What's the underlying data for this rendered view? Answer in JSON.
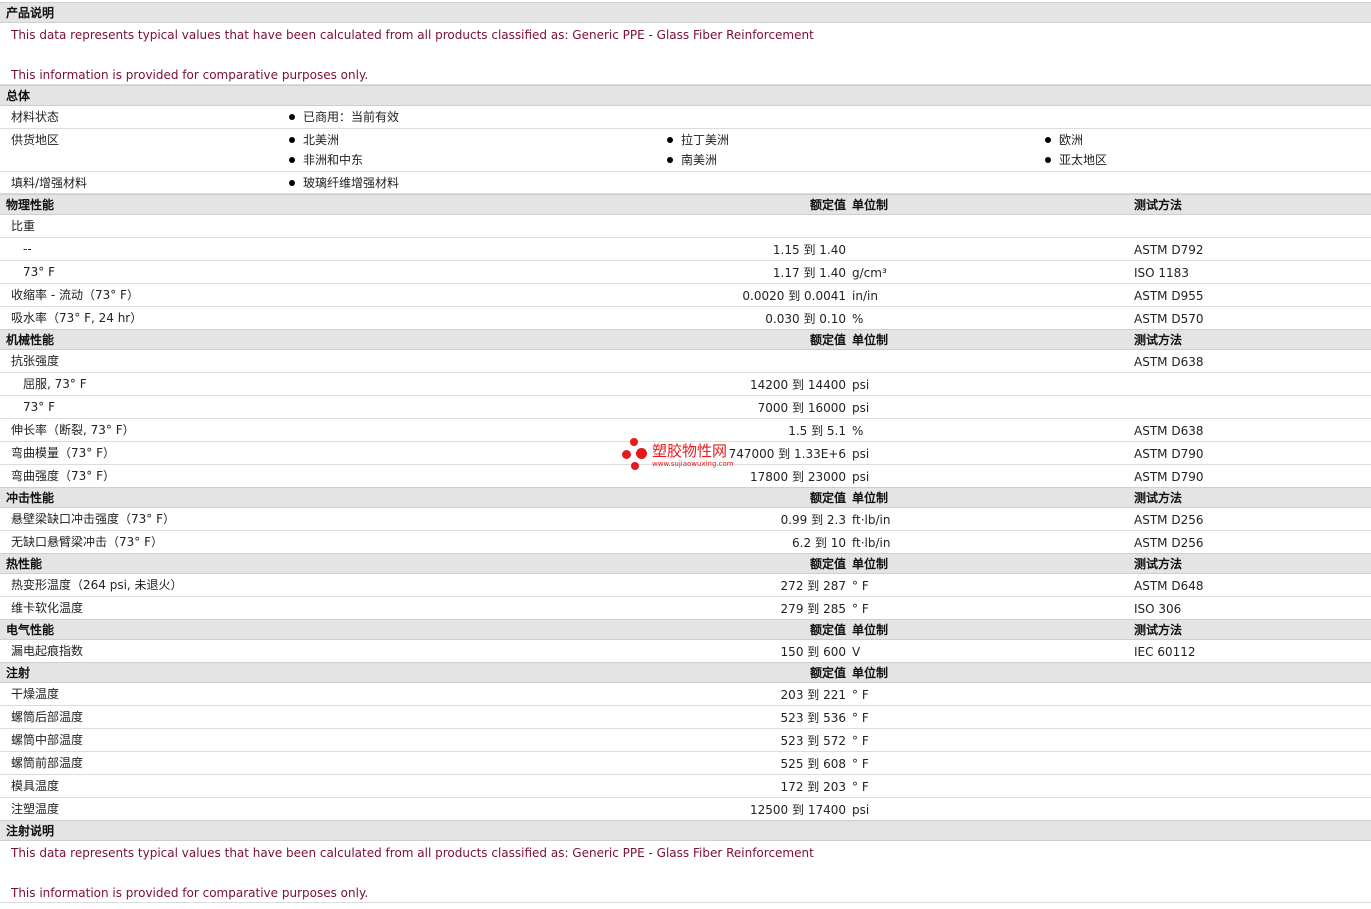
{
  "sections": {
    "desc": {
      "title": "产品说明",
      "line1": "This data represents typical values that have been calculated from all products classified as: Generic PPE - Glass Fiber Reinforcement",
      "line2": "This information is provided for comparative purposes only."
    },
    "general": {
      "title": "总体",
      "status_label": "材料状态",
      "status_value": "已商用：当前有效",
      "avail_label": "供货地区",
      "regions": [
        "北美洲",
        "拉丁美洲",
        "欧洲",
        "非洲和中东",
        "南美洲",
        "亚太地区"
      ],
      "filler_label": "填料/增强材料",
      "filler_value": "玻璃纤维增强材料"
    },
    "physical": {
      "title": "物理性能",
      "col_value": "额定值",
      "col_unit": "单位制",
      "col_method": "测试方法",
      "rows": [
        {
          "label": "比重",
          "value": "",
          "unit": "",
          "method": ""
        },
        {
          "label": "--",
          "value": "1.15 到  1.40",
          "unit": "",
          "method": "ASTM D792"
        },
        {
          "label": "73° F",
          "value": "1.17 到  1.40",
          "unit": "g/cm³",
          "method": "ISO 1183"
        },
        {
          "label": "收缩率 - 流动（73° F）",
          "value": "0.0020 到  0.0041",
          "unit": "in/in",
          "method": "ASTM D955"
        },
        {
          "label": "吸水率（73° F, 24 hr）",
          "value": "0.030 到  0.10",
          "unit": "%",
          "method": "ASTM D570"
        }
      ]
    },
    "mechanical": {
      "title": "机械性能",
      "col_value": "额定值",
      "col_unit": "单位制",
      "col_method": "测试方法",
      "rows": [
        {
          "label": "抗张强度",
          "value": "",
          "unit": "",
          "method": "ASTM D638"
        },
        {
          "label": "屈服, 73° F",
          "value": "14200 到  14400",
          "unit": "psi",
          "method": ""
        },
        {
          "label": "73° F",
          "value": "7000 到  16000",
          "unit": "psi",
          "method": ""
        },
        {
          "label": "伸长率（断裂, 73° F）",
          "value": "1.5 到  5.1",
          "unit": "%",
          "method": "ASTM D638"
        },
        {
          "label": "弯曲模量（73° F）",
          "value": "747000 到  1.33E+6",
          "unit": "psi",
          "method": "ASTM D790"
        },
        {
          "label": "弯曲强度（73° F）",
          "value": "17800 到  23000",
          "unit": "psi",
          "method": "ASTM D790"
        }
      ]
    },
    "impact": {
      "title": "冲击性能",
      "col_value": "额定值",
      "col_unit": "单位制",
      "col_method": "测试方法",
      "rows": [
        {
          "label": "悬壁梁缺口冲击强度（73° F）",
          "value": "0.99 到  2.3",
          "unit": "ft·lb/in",
          "method": "ASTM D256"
        },
        {
          "label": "无缺口悬臂梁冲击（73° F）",
          "value": "6.2 到  10",
          "unit": "ft·lb/in",
          "method": "ASTM D256"
        }
      ]
    },
    "thermal": {
      "title": "热性能",
      "col_value": "额定值",
      "col_unit": "单位制",
      "col_method": "测试方法",
      "rows": [
        {
          "label": "热变形温度（264 psi, 未退火）",
          "value": "272 到  287",
          "unit": "° F",
          "method": "ASTM D648"
        },
        {
          "label": "维卡软化温度",
          "value": "279 到  285",
          "unit": "° F",
          "method": "ISO 306"
        }
      ]
    },
    "electrical": {
      "title": "电气性能",
      "col_value": "额定值",
      "col_unit": "单位制",
      "col_method": "测试方法",
      "rows": [
        {
          "label": "漏电起痕指数",
          "value": "150 到  600",
          "unit": "V",
          "method": "IEC 60112"
        }
      ]
    },
    "injection": {
      "title": "注射",
      "col_value": "额定值",
      "col_unit": "单位制",
      "rows": [
        {
          "label": "干燥温度",
          "value": "203 到  221",
          "unit": "° F",
          "method": ""
        },
        {
          "label": "螺筒后部温度",
          "value": "523 到  536",
          "unit": "° F",
          "method": ""
        },
        {
          "label": "螺筒中部温度",
          "value": "523 到  572",
          "unit": "° F",
          "method": ""
        },
        {
          "label": "螺筒前部温度",
          "value": "525 到  608",
          "unit": "° F",
          "method": ""
        },
        {
          "label": "模具温度",
          "value": "172 到  203",
          "unit": "° F",
          "method": ""
        },
        {
          "label": "注塑温度",
          "value": "12500 到  17400",
          "unit": "psi",
          "method": ""
        }
      ]
    },
    "injnote": {
      "title": "注射说明",
      "line1": "This data represents typical values that have been calculated from all products classified as: Generic PPE - Glass Fiber Reinforcement",
      "line2": "This information is provided for comparative purposes only."
    }
  },
  "watermark": {
    "cn": "塑胶物性网",
    "url": "www.sujiaowuxing.com"
  },
  "colors": {
    "header_bg": "#e4e4e4",
    "note_text": "#7a1030",
    "watermark": "#e8191b"
  }
}
